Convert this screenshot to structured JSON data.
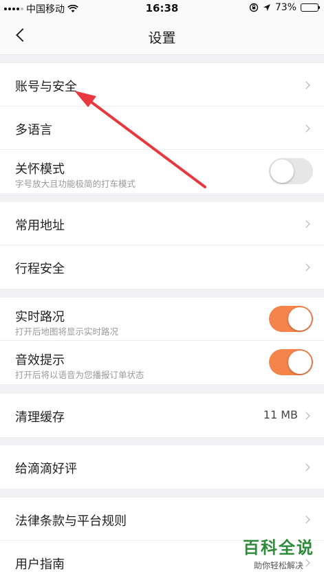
{
  "status_bar": {
    "carrier": "中国移动",
    "time": "16:38",
    "battery": "73%",
    "battery_level": 0.73,
    "icons": [
      "signal-icon",
      "wifi-icon",
      "rotation-lock-icon",
      "location-icon",
      "battery-icon"
    ]
  },
  "nav": {
    "title": "设置",
    "back_icon": "chevron-left-icon"
  },
  "groups": {
    "account": {
      "items": [
        {
          "label": "账号与安全"
        },
        {
          "label": "多语言"
        },
        {
          "label": "关怀模式",
          "sublabel": "字号放大且功能极简的打车模式",
          "toggle": false
        }
      ]
    },
    "places": {
      "items": [
        {
          "label": "常用地址"
        },
        {
          "label": "行程安全"
        }
      ]
    },
    "map": {
      "items": [
        {
          "label": "实时路况",
          "sublabel": "打开后地图将显示实时路况",
          "toggle": true
        },
        {
          "label": "音效提示",
          "sublabel": "打开后将以语音为您播报订单状态",
          "toggle": true
        }
      ]
    },
    "cache": {
      "items": [
        {
          "label": "清理缓存",
          "value": "11 MB"
        }
      ]
    },
    "rate": {
      "items": [
        {
          "label": "给滴滴好评"
        }
      ]
    },
    "legal": {
      "items": [
        {
          "label": "法律条款与平台规则"
        },
        {
          "label": "用户指南"
        }
      ]
    }
  },
  "colors": {
    "accent": "#f4844a",
    "annotation": "#e8383d",
    "watermark": "#2e8b3a"
  },
  "watermark": {
    "main": "百科全说",
    "sub": "助你轻松解决"
  }
}
